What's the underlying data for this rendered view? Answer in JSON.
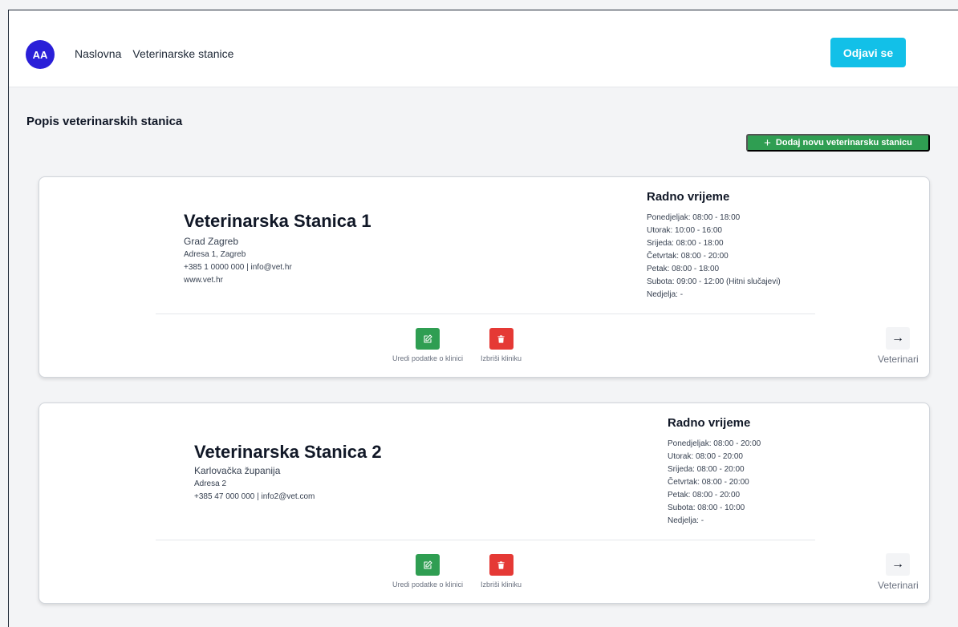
{
  "navbar": {
    "avatar_initials": "AA",
    "links": [
      "Naslovna",
      "Veterinarske stanice"
    ],
    "logout_label": "Odjavi se"
  },
  "page": {
    "title": "Popis veterinarskih stanica",
    "add_button_label": "Dodaj novu veterinarsku stanicu"
  },
  "clinics": [
    {
      "name": "Veterinarska Stanica 1",
      "region": "Grad Zagreb",
      "address": "Adresa 1, Zagreb",
      "contact": "+385 1 0000 000 | info@vet.hr",
      "website": "www.vet.hr",
      "hours_title": "Radno vrijeme",
      "hours": [
        "Ponedjeljak: 08:00 - 18:00",
        "Utorak: 10:00 - 16:00",
        "Srijeda: 08:00 - 18:00",
        "Četvrtak: 08:00 - 20:00",
        "Petak: 08:00 - 18:00",
        "Subota: 09:00 - 12:00 (Hitni slučajevi)",
        "Nedjelja: -"
      ],
      "edit_label": "Uredi podatke o klinici",
      "delete_label": "Izbriši kliniku",
      "vets_label": "Veterinari"
    },
    {
      "name": "Veterinarska Stanica 2",
      "region": "Karlovačka županija",
      "address": "Adresa 2",
      "contact": "+385 47 000 000 | info2@vet.com",
      "website": "",
      "hours_title": "Radno vrijeme",
      "hours": [
        "Ponedjeljak: 08:00 - 20:00",
        "Utorak: 08:00 - 20:00",
        "Srijeda: 08:00 - 20:00",
        "Četvrtak: 08:00 - 20:00",
        "Petak: 08:00 - 20:00",
        "Subota: 08:00 - 10:00",
        "Nedjelja: -"
      ],
      "edit_label": "Uredi podatke o klinici",
      "delete_label": "Izbriši kliniku",
      "vets_label": "Veterinari"
    }
  ],
  "colors": {
    "avatar": "#2a1fd8",
    "logout": "#12c0e8",
    "success": "#2f9e52",
    "danger": "#e53935"
  },
  "icons": {
    "add": "plus-icon",
    "edit": "edit-icon",
    "delete": "trash-icon",
    "vets": "arrow-right-icon"
  }
}
